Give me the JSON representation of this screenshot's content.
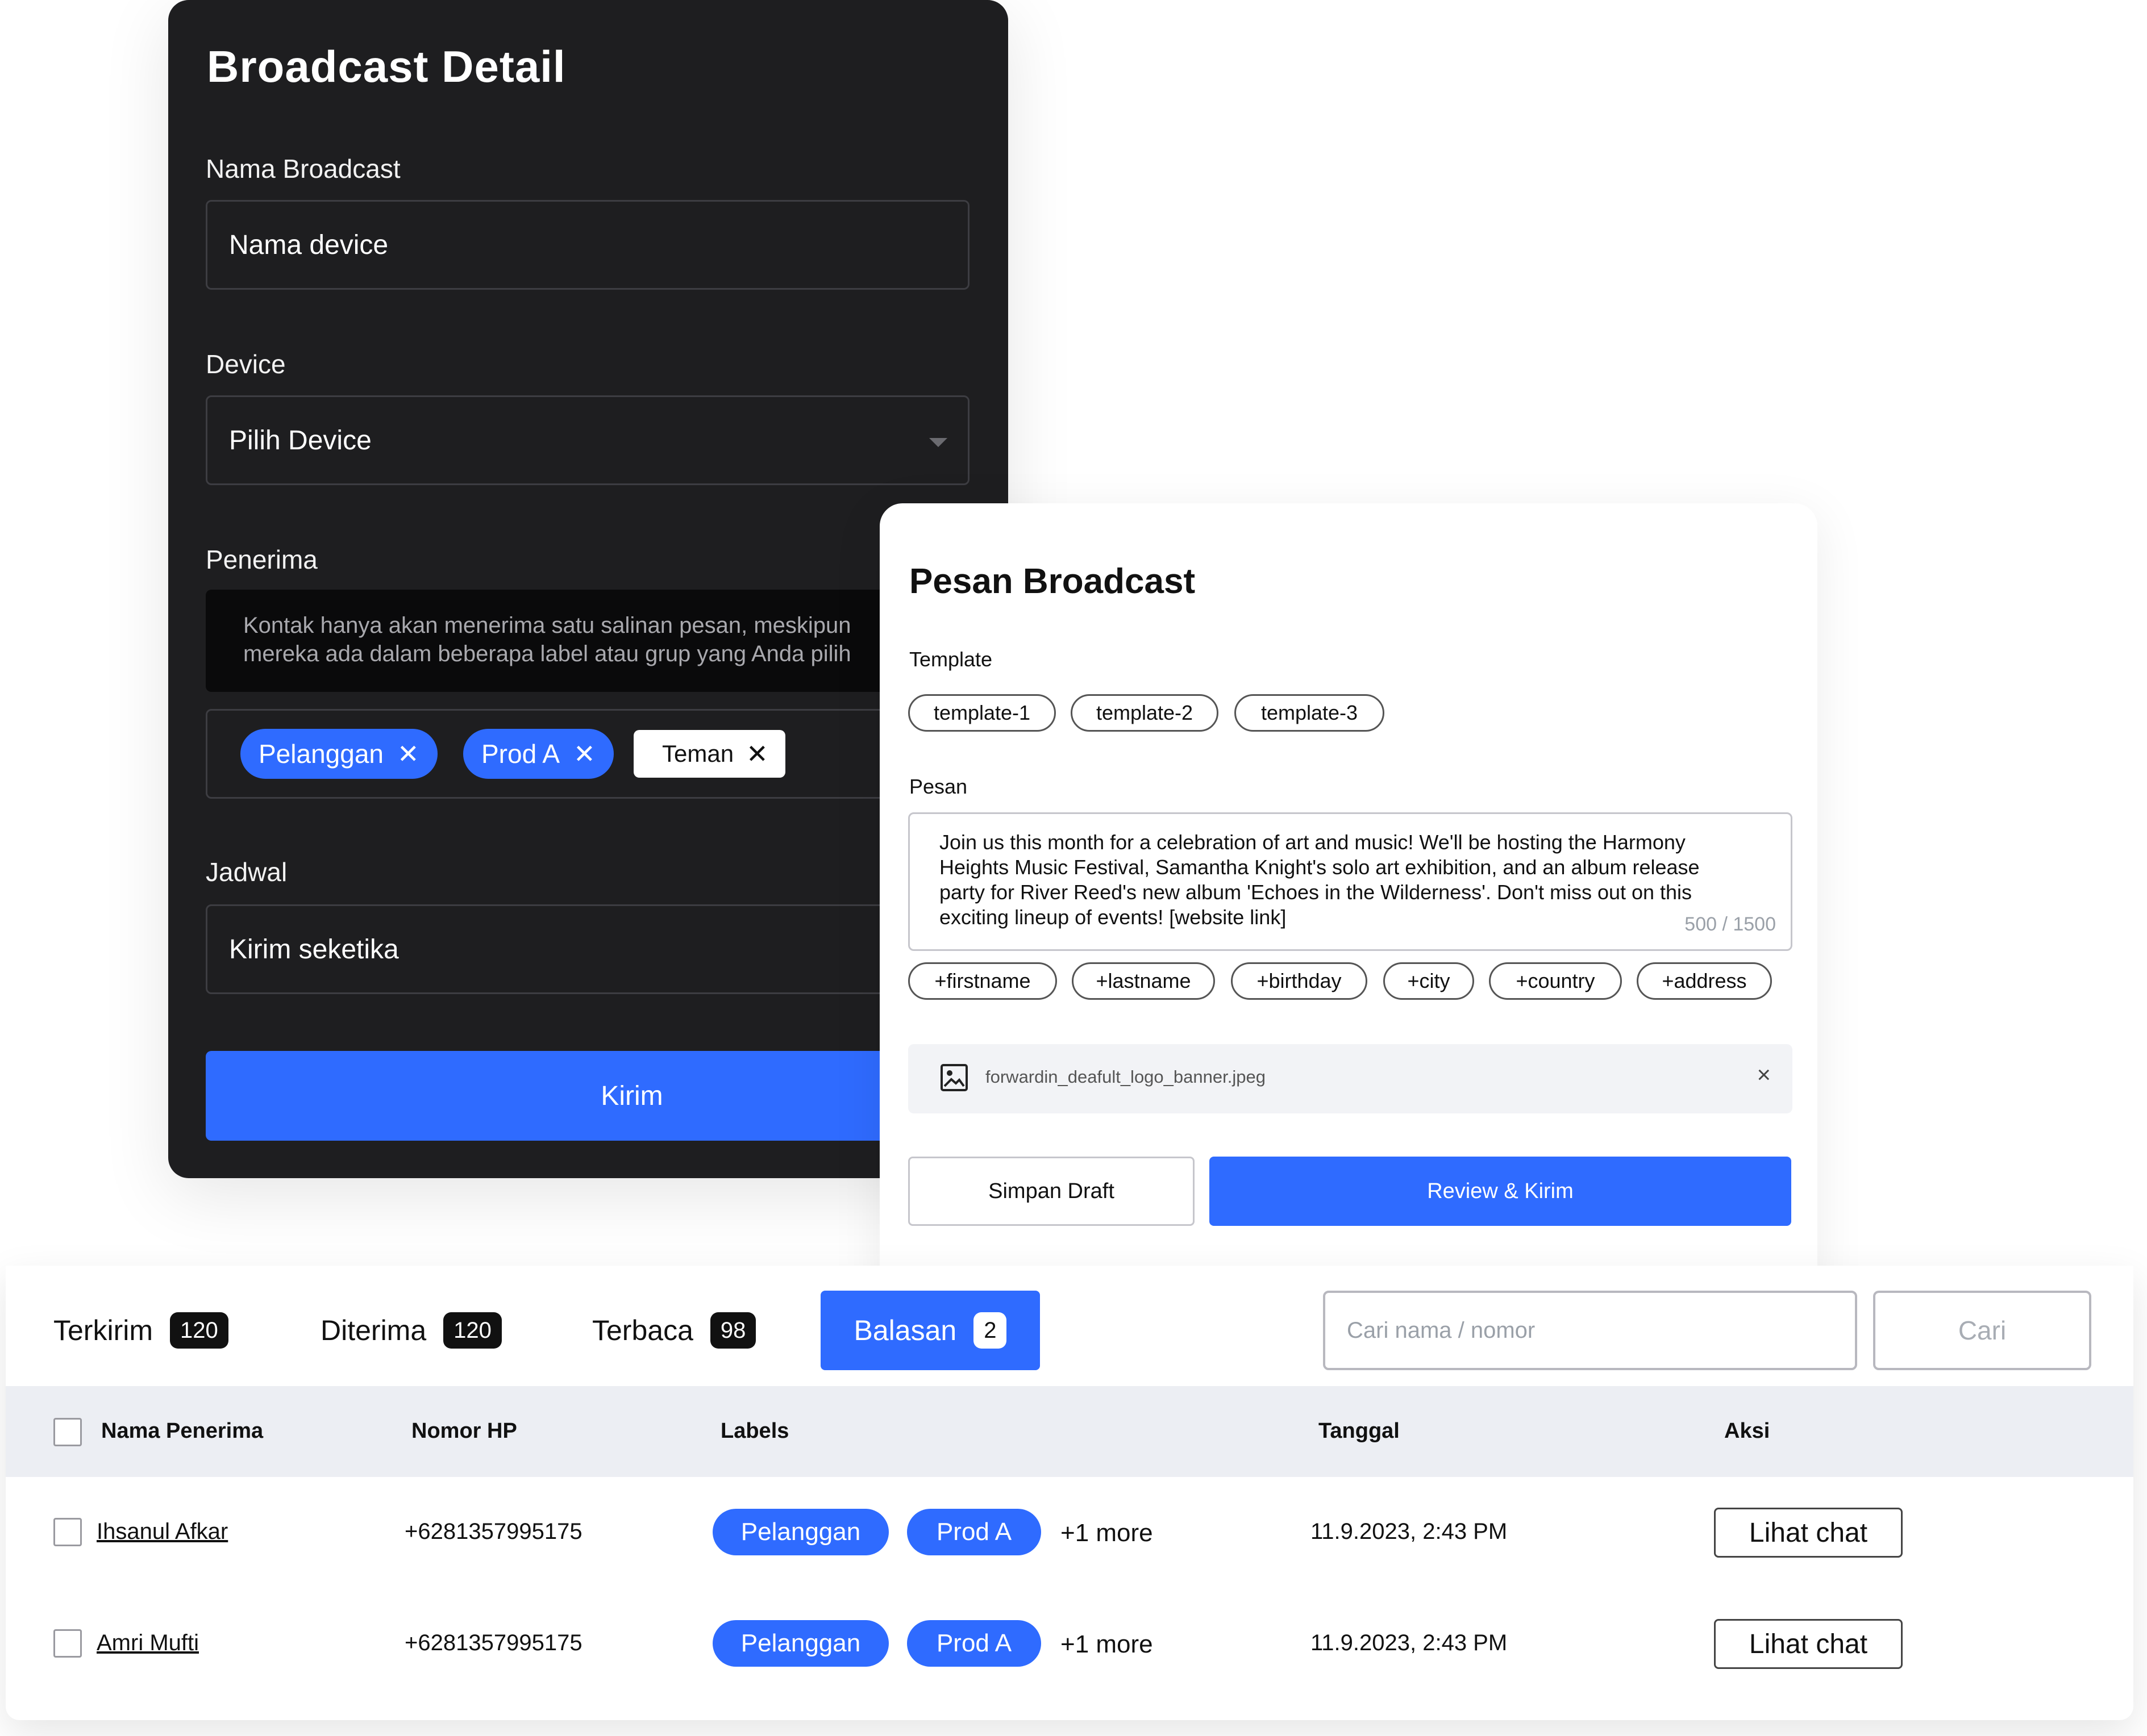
{
  "broadcast_detail": {
    "title": "Broadcast Detail",
    "nama_label": "Nama Broadcast",
    "nama_placeholder": "Nama device",
    "device_label": "Device",
    "device_value": "Pilih Device",
    "penerima_label": "Penerima",
    "info_line1": "Kontak hanya akan menerima satu salinan pesan, meskipun",
    "info_line2": "mereka ada dalam beberapa label atau grup yang Anda pilih",
    "tags": [
      "Pelanggan",
      "Prod A",
      "Teman"
    ],
    "jadwal_label": "Jadwal",
    "jadwal_value": "Kirim seketika",
    "submit_label": "Kirim"
  },
  "pesan_broadcast": {
    "title": "Pesan Broadcast",
    "template_label": "Template",
    "templates": [
      "template-1",
      "template-2",
      "template-3"
    ],
    "pesan_label": "Pesan",
    "message_lines": [
      "Join us this month for a celebration of art and music! We'll be hosting the Harmony",
      "Heights Music Festival, Samantha Knight's solo art exhibition, and an album release",
      "party for River Reed's new album 'Echoes in the Wilderness'. Don't miss out on this",
      "exciting lineup of events! [website link]"
    ],
    "char_count": "500 / 1500",
    "variables": [
      "+firstname",
      "+lastname",
      "+birthday",
      "+city",
      "+country",
      "+address"
    ],
    "attachment": "forwardin_deafult_logo_banner.jpeg",
    "attachment_close": "×",
    "draft_label": "Simpan Draft",
    "review_label": "Review & Kirim"
  },
  "stats": {
    "tabs": [
      {
        "label": "Terkirim",
        "count": "120"
      },
      {
        "label": "Diterima",
        "count": "120"
      },
      {
        "label": "Terbaca",
        "count": "98"
      },
      {
        "label": "Balasan",
        "count": "2"
      }
    ],
    "search_placeholder": "Cari nama / nomor",
    "search_button": "Cari"
  },
  "table": {
    "headers": [
      "Nama Penerima",
      "Nomor HP",
      "Labels",
      "Tanggal",
      "Aksi"
    ],
    "rows": [
      {
        "name": "Ihsanul Afkar",
        "phone": "+6281357995175",
        "labels": [
          "Pelanggan",
          "Prod A"
        ],
        "more": "+1 more",
        "date": "11.9.2023, 2:43 PM",
        "action": "Lihat chat"
      },
      {
        "name": "Amri Mufti",
        "phone": "+6281357995175",
        "labels": [
          "Pelanggan",
          "Prod A"
        ],
        "more": "+1 more",
        "date": "11.9.2023, 2:43 PM",
        "action": "Lihat chat"
      }
    ]
  },
  "colors": {
    "accent": "#2f6bff",
    "dark_panel": "#1e1e20"
  },
  "icons": [
    "close-icon",
    "chevron-down-icon",
    "image-icon"
  ]
}
